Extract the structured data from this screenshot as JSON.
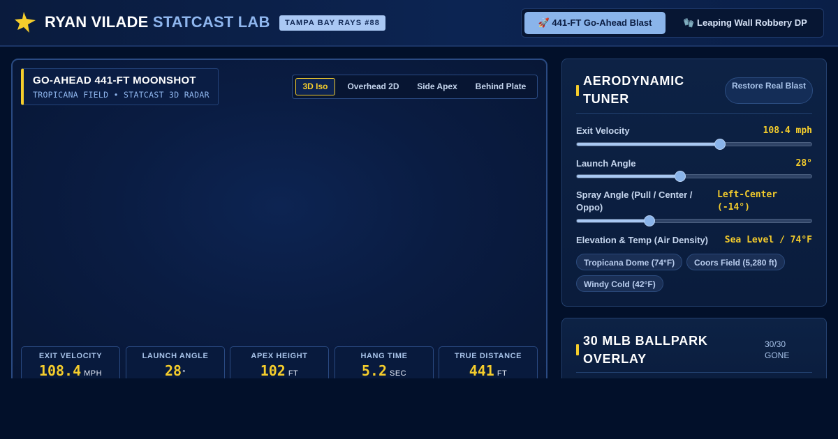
{
  "header": {
    "brand_name": "RYAN VILADE",
    "brand_suffix": "STATCAST LAB",
    "team_badge": "TAMPA BAY RAYS #88",
    "logo_icon": "star-icon",
    "plays": [
      {
        "label": "🚀 441-FT Go-Ahead Blast",
        "active": true
      },
      {
        "label": "🧤 Leaping Wall Robbery DP",
        "active": false
      }
    ]
  },
  "viz": {
    "title": "GO-AHEAD 441-FT MOONSHOT",
    "subtitle": "TROPICANA FIELD • STATCAST 3D RADAR",
    "views": [
      {
        "label": "3D Iso",
        "active": true
      },
      {
        "label": "Overhead 2D",
        "active": false
      },
      {
        "label": "Side Apex",
        "active": false
      },
      {
        "label": "Behind Plate",
        "active": false
      }
    ],
    "stats": [
      {
        "label": "EXIT VELOCITY",
        "value": "108.4",
        "unit": "MPH"
      },
      {
        "label": "LAUNCH ANGLE",
        "value": "28",
        "unit": "°"
      },
      {
        "label": "APEX HEIGHT",
        "value": "102",
        "unit": "FT"
      },
      {
        "label": "HANG TIME",
        "value": "5.2",
        "unit": "SEC"
      },
      {
        "label": "TRUE DISTANCE",
        "value": "441",
        "unit": "FT"
      }
    ]
  },
  "tuner": {
    "title": "AERODYNAMIC TUNER",
    "restore_label": "Restore Real Blast",
    "controls": [
      {
        "label": "Exit Velocity",
        "value": "108.4 mph",
        "level": 0.61
      },
      {
        "label": "Launch Angle",
        "value": "28°",
        "level": 0.44
      },
      {
        "label": "Spray Angle (Pull / Center / Oppo)",
        "value": "Left-Center (-14°)",
        "level": 0.31
      }
    ],
    "environment": {
      "label": "Elevation & Temp (Air Density)",
      "value": "Sea Level / 74°F",
      "presets": [
        "Tropicana Dome (74°F)",
        "Coors Field (5,280 ft)",
        "Windy Cold (42°F)"
      ]
    }
  },
  "ballparks": {
    "title": "30 MLB BALLPARK OVERLAY",
    "count": "30/30 GONE"
  },
  "colors": {
    "accent": "#f5cd2c",
    "primary": "#8ab4ea",
    "background": "#02102a"
  }
}
